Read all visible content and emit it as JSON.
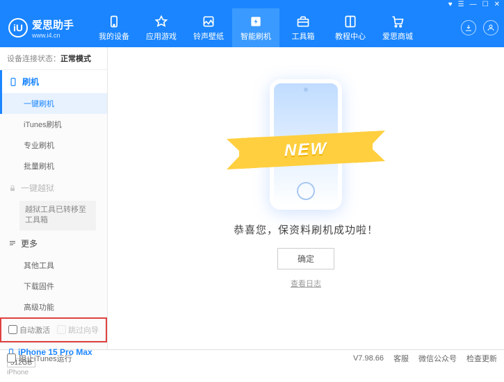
{
  "titlebar": {
    "gift": "♥",
    "menu": "☰",
    "min": "—",
    "max": "☐",
    "close": "✕"
  },
  "logo": {
    "glyph": "iU",
    "title": "爱思助手",
    "sub": "www.i4.cn"
  },
  "nav": {
    "items": [
      {
        "label": "我的设备"
      },
      {
        "label": "应用游戏"
      },
      {
        "label": "铃声壁纸"
      },
      {
        "label": "智能刷机"
      },
      {
        "label": "工具箱"
      },
      {
        "label": "教程中心"
      },
      {
        "label": "爱思商城"
      }
    ]
  },
  "status": {
    "prefix": "设备连接状态：",
    "value": "正常模式"
  },
  "sidebar": {
    "flash": {
      "title": "刷机",
      "items": [
        "一键刷机",
        "iTunes刷机",
        "专业刷机",
        "批量刷机"
      ]
    },
    "jb": {
      "title": "一键越狱",
      "note": "越狱工具已转移至工具箱"
    },
    "more": {
      "title": "更多",
      "items": [
        "其他工具",
        "下载固件",
        "高级功能"
      ]
    }
  },
  "checks": {
    "autoActivate": "自动激活",
    "skipSetup": "跳过向导"
  },
  "device": {
    "name": "iPhone 15 Pro Max",
    "capacity": "512GB",
    "type": "iPhone"
  },
  "main": {
    "ribbon": "NEW",
    "message": "恭喜您，保资料刷机成功啦！",
    "ok": "确定",
    "log": "查看日志"
  },
  "footer": {
    "blockItunes": "阻止iTunes运行",
    "version": "V7.98.66",
    "cs": "客服",
    "wechat": "微信公众号",
    "update": "检查更新"
  }
}
